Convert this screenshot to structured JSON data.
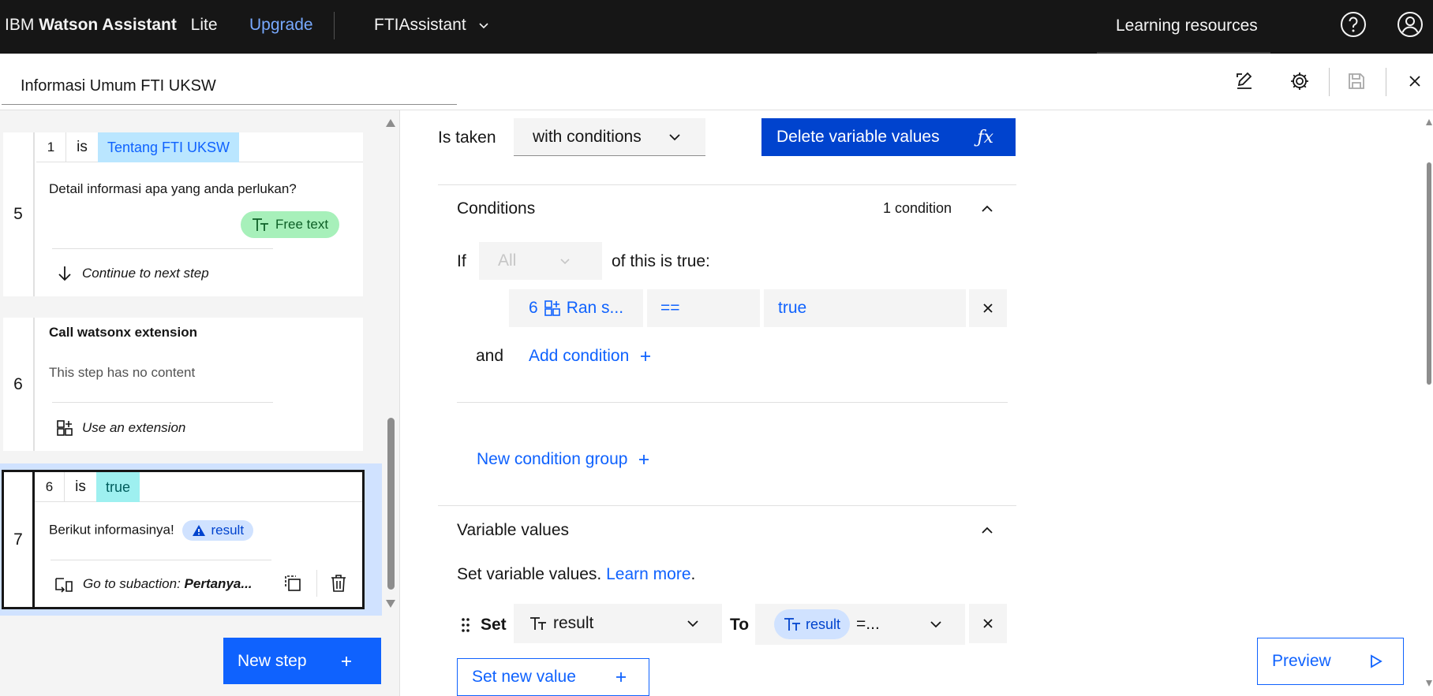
{
  "topbar": {
    "brand_prefix": "IBM",
    "brand_name": "Watson Assistant",
    "plan": "Lite",
    "upgrade_label": "Upgrade",
    "assistant_name": "FTIAssistant",
    "learning_label": "Learning resources",
    "icons": [
      "help-icon",
      "user-icon",
      "chevron-down-icon"
    ]
  },
  "action": {
    "title": "Informasi Umum FTI UKSW",
    "icons": [
      "edit-icon",
      "settings-icon",
      "save-icon",
      "close-icon"
    ]
  },
  "steps": [
    {
      "number": "5",
      "condition_step": "1",
      "condition_op": "is",
      "condition_value": "Tentang FTI UKSW",
      "text": "Detail informasi apa yang anda perlukan?",
      "response_type": "Free text",
      "footer": "Continue to next step"
    },
    {
      "number": "6",
      "title": "Call watsonx extension",
      "text": "This step has no content",
      "footer": "Use an extension"
    },
    {
      "number": "7",
      "condition_step": "6",
      "condition_op": "is",
      "condition_value": "true",
      "text": "Berikut informasinya!",
      "variable": "result",
      "footer_prefix": "Go to subaction: ",
      "footer_target": "Pertanya..."
    }
  ],
  "new_step_label": "New step",
  "main": {
    "is_taken_label": "Is taken",
    "is_taken_value": "with conditions",
    "delete_button": "Delete variable values",
    "delete_button_icon": "ƒx",
    "conditions": {
      "title": "Conditions",
      "count": "1 condition",
      "if_label": "If",
      "all_value": "All",
      "of_true": "of this is true:",
      "row": {
        "step": "6",
        "subject": "Ran s...",
        "operator": "==",
        "value": "true"
      },
      "and_label": "and",
      "add_condition": "Add condition",
      "new_group": "New condition group"
    },
    "variables": {
      "title": "Variable values",
      "description": "Set variable values.",
      "learn_more": "Learn more",
      "period": ".",
      "set_label": "Set",
      "variable_name": "result",
      "to_label": "To",
      "value_var": "result",
      "value_suffix": "=...",
      "set_new": "Set new value"
    },
    "preview_label": "Preview"
  },
  "colors": {
    "topbar": "#161616",
    "primary": "#0f62fe",
    "primary_dark": "#0043ce",
    "selected_bg": "#d0e2ff",
    "free_text_tag": "#a7f0ba",
    "condition_tag": "#bae6ff",
    "true_tag": "#9ef0f0"
  }
}
